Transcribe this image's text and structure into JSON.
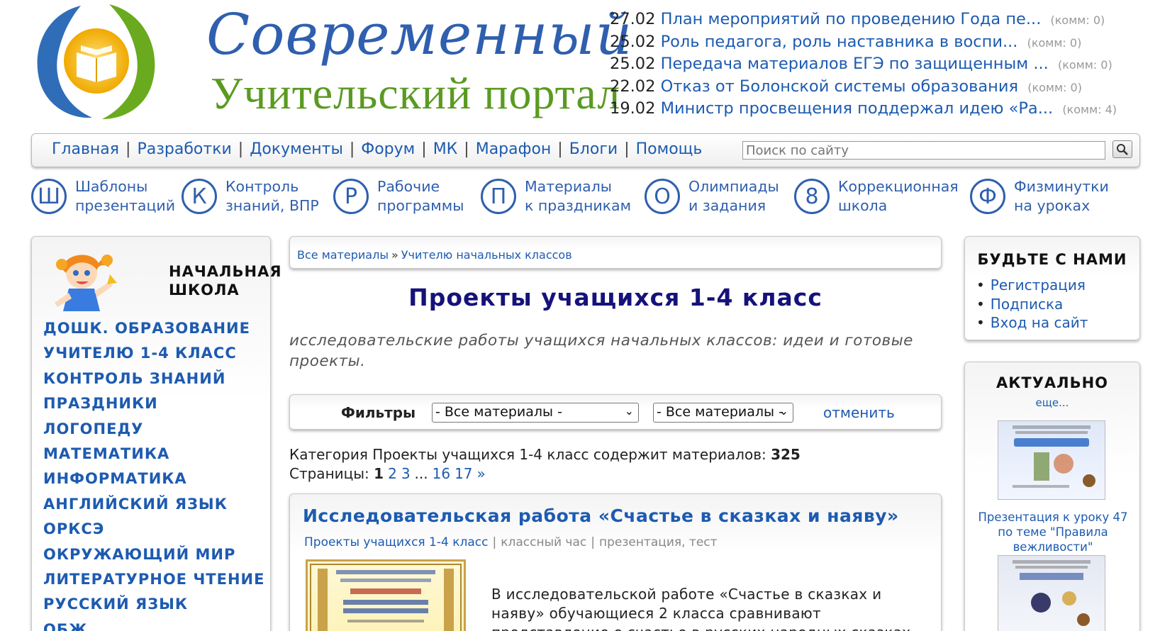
{
  "site": {
    "title_line1": "Современный",
    "title_line2": "Учительский портал"
  },
  "news": [
    {
      "date": "27.02",
      "title": "План мероприятий по проведению Года пе...",
      "comments": "(комм: 0)"
    },
    {
      "date": "25.02",
      "title": "Роль педагога, роль наставника в воспи...",
      "comments": "(комм: 0)"
    },
    {
      "date": "25.02",
      "title": "Передача материалов ЕГЭ по защищенным ...",
      "comments": "(комм: 0)"
    },
    {
      "date": "22.02",
      "title": "Отказ от Болонской системы образования",
      "comments": "(комм: 0)"
    },
    {
      "date": "19.02",
      "title": "Министр просвещения поддержал идею «Ра...",
      "comments": "(комм: 4)"
    }
  ],
  "nav": {
    "items": [
      "Главная",
      "Разработки",
      "Документы",
      "Форум",
      "МК",
      "Марафон",
      "Блоги",
      "Помощь"
    ],
    "separator": "|",
    "search_placeholder": "Поиск по сайту"
  },
  "quick_links": [
    {
      "letter": "Ш",
      "line1": "Шаблоны",
      "line2": "презентаций"
    },
    {
      "letter": "К",
      "line1": "Контроль",
      "line2": "знаний, ВПР"
    },
    {
      "letter": "Р",
      "line1": "Рабочие",
      "line2": "программы"
    },
    {
      "letter": "П",
      "line1": "Материалы",
      "line2": "к праздникам"
    },
    {
      "letter": "О",
      "line1": "Олимпиады",
      "line2": "и задания"
    },
    {
      "letter": "8",
      "line1": "Коррекционная",
      "line2": "школа"
    },
    {
      "letter": "Ф",
      "line1": "Физминутки",
      "line2": "на уроках"
    }
  ],
  "left_panel": {
    "heading_line1": "НАЧАЛЬНАЯ",
    "heading_line2": "ШКОЛА",
    "items": [
      "ДОШК. ОБРАЗОВАНИЕ",
      "УЧИТЕЛЮ 1-4 КЛАСС",
      "КОНТРОЛЬ ЗНАНИЙ",
      "ПРАЗДНИКИ",
      "ЛОГОПЕДУ",
      "МАТЕМАТИКА",
      "ИНФОРМАТИКА",
      "АНГЛИЙСКИЙ ЯЗЫК",
      "ОРКСЭ",
      "ОКРУЖАЮЩИЙ МИР",
      "ЛИТЕРАТУРНОЕ ЧТЕНИЕ",
      "РУССКИЙ ЯЗЫК",
      "ОБЖ"
    ]
  },
  "breadcrumb": {
    "items": [
      "Все материалы",
      "Учителю начальных классов"
    ],
    "separator": "»"
  },
  "page": {
    "title": "Проекты учащихся 1-4 класс",
    "description": "исследовательские работы учащихся начальных классов: идеи и готовые проекты."
  },
  "filters": {
    "label": "Фильтры",
    "select1": "- Все материалы -",
    "select2": "- Все материалы -",
    "cancel": "отменить"
  },
  "category": {
    "text": "Категория Проекты учащихся 1-4 класс содержит материалов:",
    "count": "325",
    "pages_label": "Страницы:",
    "current_page": "1",
    "pages": [
      "2",
      "3"
    ],
    "ellipsis": "...",
    "last_pages": [
      "16",
      "17"
    ],
    "next": "»"
  },
  "article": {
    "title": "Исследовательская работа «Счастье в сказках и наяву»",
    "tags": [
      "Проекты учащихся 1-4 класс",
      "классный час",
      "презентация, тест"
    ],
    "text": "В исследовательской работе «Счастье в сказках и наяву» обучающиеся 2 класса сравнивают представление о счастье в русских народных сказках и"
  },
  "right_panel1": {
    "heading": "БУДЬТЕ С НАМИ",
    "items": [
      "Регистрация",
      "Подписка",
      "Вход на сайт"
    ]
  },
  "right_panel2": {
    "heading": "АКТУАЛЬНО",
    "more": "еще...",
    "caption": "Презентация к уроку 47 по теме \"Правила вежливости\""
  },
  "colors": {
    "link": "#1d5bb0",
    "title_dark": "#16127a",
    "logo_blue": "#2f5fae",
    "logo_green": "#5a9a22"
  },
  "icons": {
    "search": "magnifier-icon",
    "logo": "book-logo-icon",
    "mascot": "girl-with-bell-icon"
  }
}
